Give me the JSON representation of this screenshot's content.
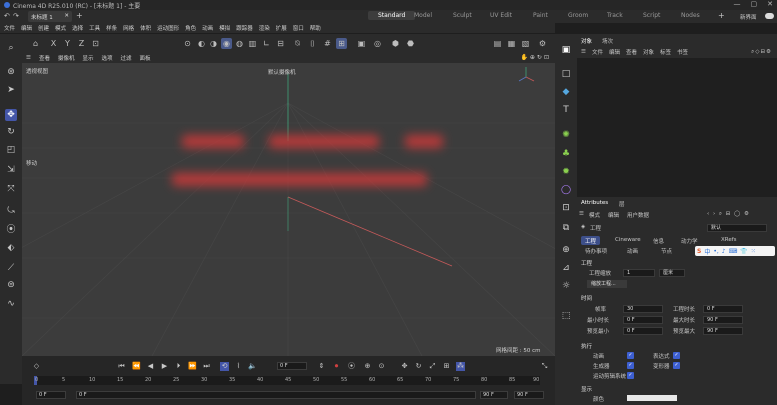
{
  "title_bar": {
    "title": "Cinema 4D R25.010 (RC) - [未标题 1] - 主要",
    "minimize": "—",
    "maximize": "▢",
    "close": "✕"
  },
  "doc_tab": {
    "label": "未标题 1",
    "close": "✕",
    "add": "+"
  },
  "layout_tabs": [
    "Standard",
    "Model",
    "Sculpt",
    "UV Edit",
    "Paint",
    "Groom",
    "Track",
    "Script",
    "Nodes"
  ],
  "layout_tab_active": "Standard",
  "top_right": {
    "add": "+",
    "new_layout": "新界面",
    "toggle": ""
  },
  "menu": [
    "文件",
    "编辑",
    "创建",
    "模式",
    "选择",
    "工具",
    "样条",
    "网格",
    "体积",
    "运动图形",
    "角色",
    "动画",
    "模拟",
    "跟踪器",
    "渲染",
    "扩展",
    "窗口",
    "帮助"
  ],
  "toolbar": {
    "axes": [
      "X",
      "Y",
      "Z"
    ],
    "icons": [
      "undo-icon",
      "box-icon",
      "snap-icon",
      "axis-icon",
      "render-icon"
    ]
  },
  "viewport": {
    "menu": [
      "查看",
      "摄像机",
      "显示",
      "选项",
      "过滤",
      "面板"
    ],
    "label_view": "透视视图",
    "label_camera": "默认摄像机",
    "label_move": "移动",
    "grid_spacing": "网格间距 : 50 cm",
    "grid_color": "#4a4a4a",
    "bg_color": "#3c3c3c"
  },
  "timeline": {
    "current_frame": "0 F",
    "ruler": [
      "0",
      "5",
      "10",
      "15",
      "20",
      "25",
      "30",
      "35",
      "40",
      "45",
      "50",
      "55",
      "60",
      "65",
      "70",
      "75",
      "80",
      "85",
      "90"
    ],
    "start_a": "0 F",
    "start_b": "0 F",
    "end_a": "90 F",
    "end_b": "90 F"
  },
  "object_manager": {
    "tabs": [
      "对象",
      "场次"
    ],
    "menu": [
      "文件",
      "编辑",
      "查看",
      "对象",
      "标签",
      "书签"
    ]
  },
  "attributes": {
    "title": "Attributes",
    "title_extra": "层",
    "menu": [
      "模式",
      "编辑",
      "用户数据"
    ],
    "section_label": "工程",
    "preset": "默认",
    "tabs": [
      "工程",
      "Cineware",
      "信息",
      "动力学",
      "XRefs"
    ],
    "tabs_row2": [
      "待办事项",
      "动画",
      "节点"
    ],
    "ime": "中",
    "group_project": "工程",
    "scale_label": "工程缩放",
    "scale_value": "1",
    "scale_unit": "厘米",
    "scale_button": "缩放工程...",
    "group_time": "时间",
    "fps_label": "帧率",
    "fps_value": "30",
    "proj_time_label": "工程时长",
    "proj_time_value": "0 F",
    "min_time_label": "最小时长",
    "min_time_value": "0 F",
    "max_time_label": "最大时长",
    "max_time_value": "90 F",
    "preview_min_label": "预览最小",
    "preview_min_value": "0 F",
    "preview_max_label": "预览最大",
    "preview_max_value": "90 F",
    "group_exec": "执行",
    "exec_items": [
      "动画",
      "生成器",
      "运动剪辑系统"
    ],
    "exec_items_right": [
      "表达式",
      "变形器"
    ],
    "group_display": "显示",
    "display_label": "颜色"
  },
  "colors": {
    "accent": "#4456a8",
    "selection_blue": "#3d5fd0",
    "blurred_text": "#c43a3a",
    "y_axis": "#3fa37a",
    "x_axis": "#c55a5a"
  }
}
